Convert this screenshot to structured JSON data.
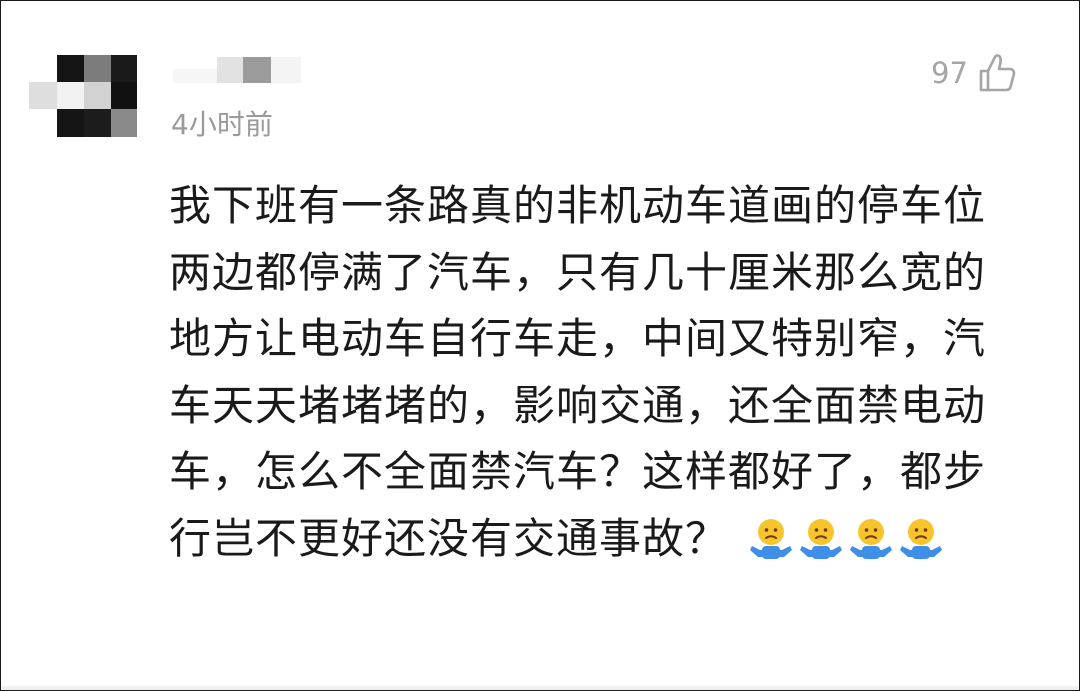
{
  "comment": {
    "timestamp": "4小时前",
    "like_count": "97",
    "text": "我下班有一条路真的非机动车道画的停车位两边都停满了汽车，只有几十厘米那么宽的地方让电动车自行车走，中间又特别窄，汽车天天堵堵堵的，影响交通，还全面禁电动车，怎么不全面禁汽车？这样都好了，都步行岂不更好还没有交通事故？",
    "emojis": [
      "shrug-emoji",
      "shrug-emoji",
      "shrug-emoji",
      "shrug-emoji"
    ]
  },
  "colors": {
    "text": "#1a1a1a",
    "meta": "#9a9a9a",
    "like": "#a5a5a5",
    "emoji_face": "#f7c52b",
    "emoji_body": "#3f8fe8"
  },
  "icons": {
    "like": "thumbs-up-icon",
    "avatar": "pixelated-avatar"
  }
}
